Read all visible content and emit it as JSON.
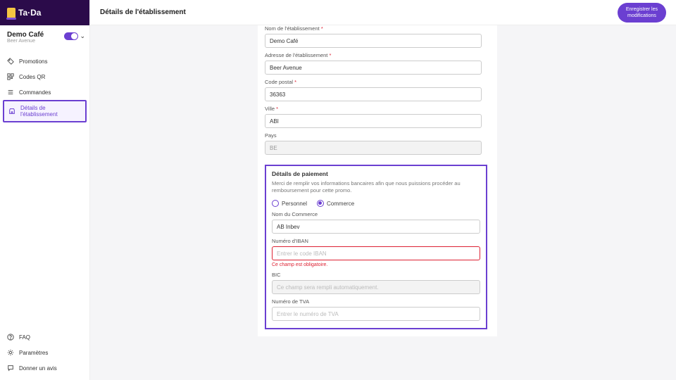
{
  "brand": {
    "name": "Ta·Da"
  },
  "venue": {
    "name": "Demo Café",
    "subtitle": "Beer Avenue"
  },
  "nav": {
    "promotions": "Promotions",
    "qrcodes": "Codes QR",
    "orders": "Commandes",
    "venue_details": "Détails de l'établissement"
  },
  "bottom_nav": {
    "faq": "FAQ",
    "settings": "Paramètres",
    "feedback": "Donner un avis"
  },
  "header": {
    "title": "Détails de l'établissement",
    "save_line1": "Enregistrer les",
    "save_line2": "modifications"
  },
  "form": {
    "venue_name_label": "Nom de l'établissement",
    "venue_name_value": "Demo Café",
    "address_label": "Adresse de l'établissement",
    "address_value": "Beer Avenue",
    "postal_label": "Code postal",
    "postal_value": "36363",
    "city_label": "Ville",
    "city_value": "ABI",
    "country_label": "Pays",
    "country_value": "BE"
  },
  "payment": {
    "section_title": "Détails de paiement",
    "section_desc": "Merci de remplir vos informations bancaires afin que nous puissions procéder au remboursement pour cette promo.",
    "radio_personal": "Personnel",
    "radio_business": "Commerce",
    "business_name_label": "Nom du Commerce",
    "business_name_value": "AB Inbev",
    "iban_label": "Numéro d'IBAN",
    "iban_placeholder": "Entrer le code IBAN",
    "iban_error": "Ce champ est obligatoire.",
    "bic_label": "BIC",
    "bic_placeholder": "Ce champ sera rempli automatiquement.",
    "vat_label": "Numéro de TVA",
    "vat_placeholder": "Entrer le numéro de TVA"
  }
}
